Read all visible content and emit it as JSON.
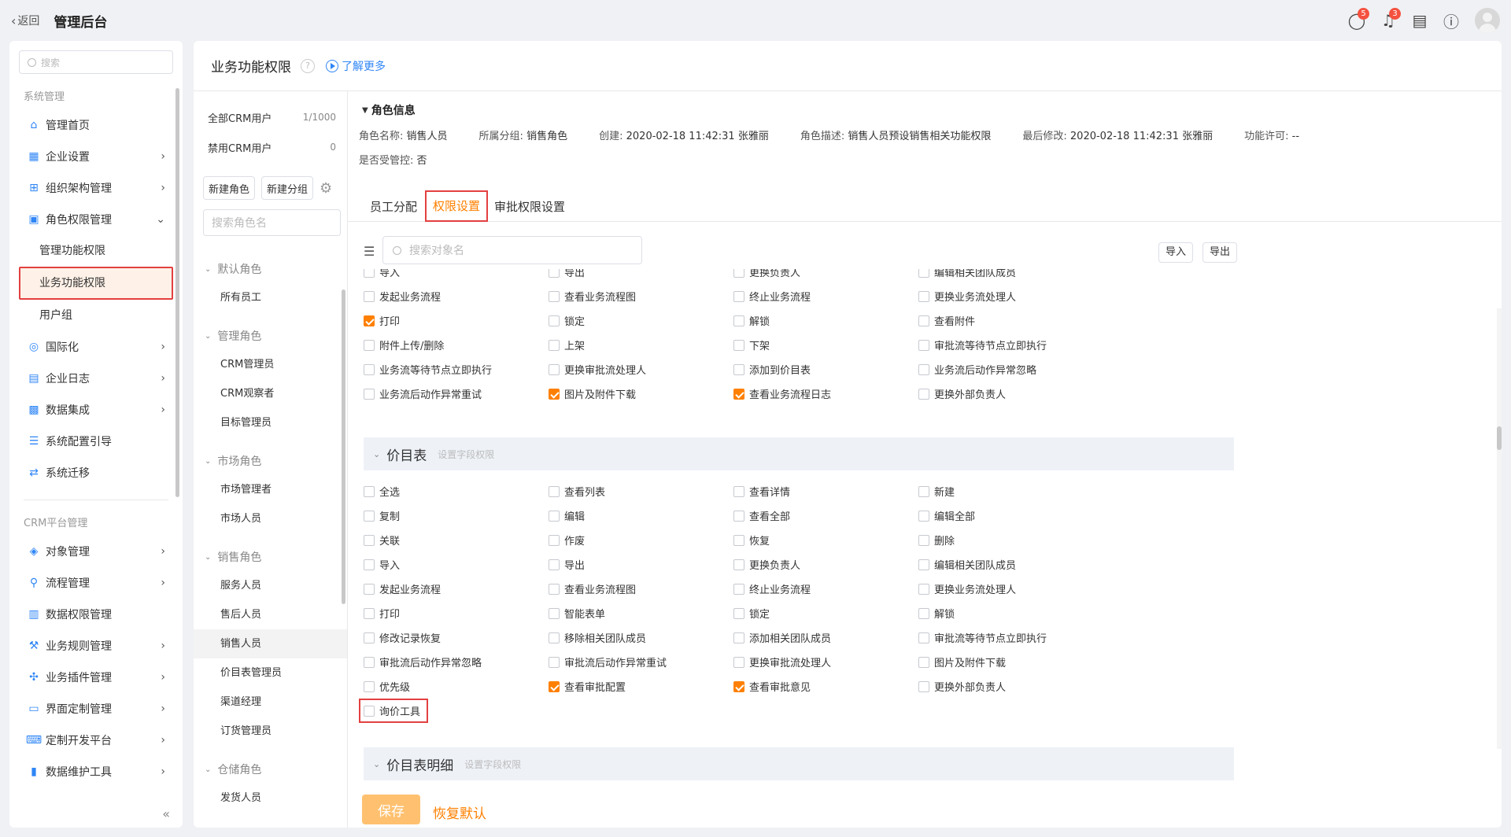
{
  "topbar": {
    "back": "返回",
    "title": "管理后台",
    "msg_badge": "5",
    "bell_badge": "3"
  },
  "sidebar": {
    "search_placeholder": "搜索",
    "group1": "系统管理",
    "items1": [
      {
        "label": "管理首页",
        "icon": "home-icon",
        "glyph": "⌂",
        "arrow": ""
      },
      {
        "label": "企业设置",
        "icon": "company-icon",
        "glyph": "▦",
        "arrow": "›"
      },
      {
        "label": "组织架构管理",
        "icon": "org-icon",
        "glyph": "⊞",
        "arrow": "›"
      },
      {
        "label": "角色权限管理",
        "icon": "role-icon",
        "glyph": "▣",
        "arrow": "⌄"
      }
    ],
    "subs": [
      "管理功能权限",
      "业务功能权限",
      "用户组"
    ],
    "items2": [
      {
        "label": "国际化",
        "icon": "globe-icon",
        "glyph": "◎",
        "arrow": "›"
      },
      {
        "label": "企业日志",
        "icon": "log-icon",
        "glyph": "▤",
        "arrow": "›"
      },
      {
        "label": "数据集成",
        "icon": "chip-icon",
        "glyph": "▩",
        "arrow": "›"
      },
      {
        "label": "系统配置引导",
        "icon": "guide-icon",
        "glyph": "☰",
        "arrow": ""
      },
      {
        "label": "系统迁移",
        "icon": "migrate-icon",
        "glyph": "⇄",
        "arrow": ""
      }
    ],
    "group2": "CRM平台管理",
    "items3": [
      {
        "label": "对象管理",
        "icon": "cube-icon",
        "glyph": "◈",
        "arrow": "›"
      },
      {
        "label": "流程管理",
        "icon": "flow-icon",
        "glyph": "⚲",
        "arrow": "›"
      },
      {
        "label": "数据权限管理",
        "icon": "data-perm-icon",
        "glyph": "▥",
        "arrow": ""
      },
      {
        "label": "业务规则管理",
        "icon": "wrench-icon",
        "glyph": "⚒",
        "arrow": "›"
      },
      {
        "label": "业务插件管理",
        "icon": "plugin-icon",
        "glyph": "✣",
        "arrow": "›"
      },
      {
        "label": "界面定制管理",
        "icon": "layout-icon",
        "glyph": "▭",
        "arrow": "›"
      },
      {
        "label": "定制开发平台",
        "icon": "code-icon",
        "glyph": "⌨",
        "arrow": "›"
      },
      {
        "label": "数据维护工具",
        "icon": "chart-icon",
        "glyph": "▮",
        "arrow": "›"
      }
    ],
    "collapse": "«"
  },
  "page": {
    "title": "业务功能权限",
    "learn_more": "了解更多"
  },
  "roles": {
    "stats": [
      {
        "label": "全部CRM用户",
        "n": "1/1000"
      },
      {
        "label": "禁用CRM用户",
        "n": "0"
      }
    ],
    "new_role": "新建角色",
    "new_group": "新建分组",
    "search_placeholder": "搜索角色名",
    "groups": [
      {
        "name": "默认角色",
        "items": [
          "所有员工"
        ]
      },
      {
        "name": "管理角色",
        "items": [
          "CRM管理员",
          "CRM观察者",
          "目标管理员"
        ]
      },
      {
        "name": "市场角色",
        "items": [
          "市场管理者",
          "市场人员"
        ]
      },
      {
        "name": "销售角色",
        "items": [
          "服务人员",
          "售后人员",
          "销售人员",
          "价目表管理员",
          "渠道经理",
          "订货管理员"
        ]
      },
      {
        "name": "仓储角色",
        "items": [
          "发货人员"
        ]
      }
    ],
    "active": "销售人员"
  },
  "role_info": {
    "title": "角色信息",
    "fields": [
      {
        "k": "角色名称:",
        "v": "销售人员"
      },
      {
        "k": "所属分组:",
        "v": "销售角色"
      },
      {
        "k": "创建:",
        "v": "2020-02-18 11:42:31 张雅丽"
      },
      {
        "k": "角色描述:",
        "v": "销售人员预设销售相关功能权限"
      },
      {
        "k": "最后修改:",
        "v": "2020-02-18 11:42:31 张雅丽"
      },
      {
        "k": "功能许可:",
        "v": "--"
      }
    ],
    "controlled_k": "是否受管控:",
    "controlled_v": "否"
  },
  "tabs": [
    "员工分配",
    "权限设置",
    "审批权限设置"
  ],
  "toolbar": {
    "search_placeholder": "搜索对象名",
    "import": "导入",
    "export": "导出"
  },
  "perm_top": [
    [
      {
        "l": "导入",
        "c": false
      },
      {
        "l": "导出",
        "c": false
      },
      {
        "l": "更换负责人",
        "c": false
      },
      {
        "l": "编辑相关团队成员",
        "c": false
      }
    ],
    [
      {
        "l": "发起业务流程",
        "c": false
      },
      {
        "l": "查看业务流程图",
        "c": false
      },
      {
        "l": "终止业务流程",
        "c": false
      },
      {
        "l": "更换业务流处理人",
        "c": false
      }
    ],
    [
      {
        "l": "打印",
        "c": true
      },
      {
        "l": "锁定",
        "c": false
      },
      {
        "l": "解锁",
        "c": false
      },
      {
        "l": "查看附件",
        "c": false
      }
    ],
    [
      {
        "l": "附件上传/删除",
        "c": false
      },
      {
        "l": "上架",
        "c": false
      },
      {
        "l": "下架",
        "c": false
      },
      {
        "l": "审批流等待节点立即执行",
        "c": false
      }
    ],
    [
      {
        "l": "业务流等待节点立即执行",
        "c": false
      },
      {
        "l": "更换审批流处理人",
        "c": false
      },
      {
        "l": "添加到价目表",
        "c": false
      },
      {
        "l": "业务流后动作异常忽略",
        "c": false
      }
    ],
    [
      {
        "l": "业务流后动作异常重试",
        "c": false
      },
      {
        "l": "图片及附件下载",
        "c": true
      },
      {
        "l": "查看业务流程日志",
        "c": true
      },
      {
        "l": "更换外部负责人",
        "c": false
      }
    ]
  ],
  "section1": {
    "title": "价目表",
    "sub": "设置字段权限"
  },
  "perm_price": [
    [
      {
        "l": "全选",
        "c": false
      },
      {
        "l": "查看列表",
        "c": false
      },
      {
        "l": "查看详情",
        "c": false
      },
      {
        "l": "新建",
        "c": false
      }
    ],
    [
      {
        "l": "复制",
        "c": false
      },
      {
        "l": "编辑",
        "c": false
      },
      {
        "l": "查看全部",
        "c": false
      },
      {
        "l": "编辑全部",
        "c": false
      }
    ],
    [
      {
        "l": "关联",
        "c": false
      },
      {
        "l": "作废",
        "c": false
      },
      {
        "l": "恢复",
        "c": false
      },
      {
        "l": "删除",
        "c": false
      }
    ],
    [
      {
        "l": "导入",
        "c": false
      },
      {
        "l": "导出",
        "c": false
      },
      {
        "l": "更换负责人",
        "c": false
      },
      {
        "l": "编辑相关团队成员",
        "c": false
      }
    ],
    [
      {
        "l": "发起业务流程",
        "c": false
      },
      {
        "l": "查看业务流程图",
        "c": false
      },
      {
        "l": "终止业务流程",
        "c": false
      },
      {
        "l": "更换业务流处理人",
        "c": false
      }
    ],
    [
      {
        "l": "打印",
        "c": false
      },
      {
        "l": "智能表单",
        "c": false
      },
      {
        "l": "锁定",
        "c": false
      },
      {
        "l": "解锁",
        "c": false
      }
    ],
    [
      {
        "l": "修改记录恢复",
        "c": false
      },
      {
        "l": "移除相关团队成员",
        "c": false
      },
      {
        "l": "添加相关团队成员",
        "c": false
      },
      {
        "l": "审批流等待节点立即执行",
        "c": false
      }
    ],
    [
      {
        "l": "审批流后动作异常忽略",
        "c": false
      },
      {
        "l": "审批流后动作异常重试",
        "c": false
      },
      {
        "l": "更换审批流处理人",
        "c": false
      },
      {
        "l": "图片及附件下载",
        "c": false
      }
    ],
    [
      {
        "l": "优先级",
        "c": false
      },
      {
        "l": "查看审批配置",
        "c": true
      },
      {
        "l": "查看审批意见",
        "c": true
      },
      {
        "l": "更换外部负责人",
        "c": false
      }
    ]
  ],
  "inquiry": {
    "l": "询价工具",
    "c": false
  },
  "section2": {
    "title": "价目表明细",
    "sub": "设置字段权限"
  },
  "footer": {
    "save": "保存",
    "reset": "恢复默认"
  }
}
